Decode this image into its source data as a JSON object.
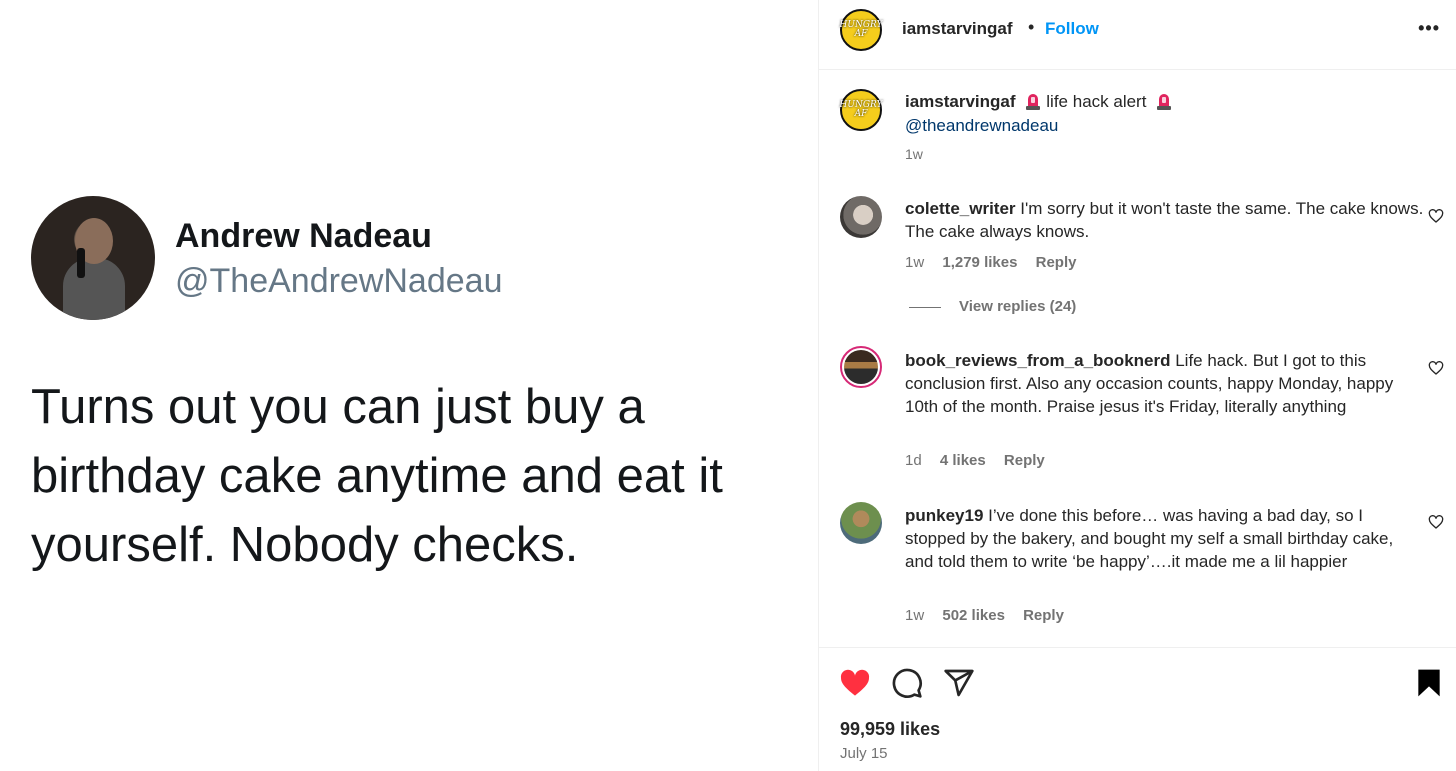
{
  "tweet": {
    "name": "Andrew Nadeau",
    "handle": "@TheAndrewNadeau",
    "text": "Turns out you can just buy a birthday cake anytime and eat it yourself. Nobody checks."
  },
  "header": {
    "username": "iamstarvingaf",
    "separator": "•",
    "follow_label": "Follow",
    "more_label": "•••",
    "avatar_text": "HUNGRY AF"
  },
  "caption": {
    "username": "iamstarvingaf",
    "text": "life hack alert",
    "mention": "@theandrewnadeau",
    "time": "1w"
  },
  "comments": [
    {
      "username": "colette_writer",
      "text": "I'm sorry but it won't taste the same. The cake knows. The cake always knows.",
      "time": "1w",
      "likes": "1,279 likes",
      "reply_label": "Reply",
      "view_replies": "View replies (24)"
    },
    {
      "username": "book_reviews_from_a_booknerd",
      "text": "Life hack. But I got to this conclusion first. Also any occasion counts, happy Monday, happy 10th of the month. Praise jesus it's Friday, literally anything",
      "time": "1d",
      "likes": "4 likes",
      "reply_label": "Reply"
    },
    {
      "username": "punkey19",
      "text": "I’ve done this before… was having a bad day, so I stopped by the bakery, and bought my self a small birthday cake, and told them to write ‘be happy’….it made me a lil happier",
      "time": "1w",
      "likes": "502 likes",
      "reply_label": "Reply"
    }
  ],
  "footer": {
    "likes": "99,959 likes",
    "date": "July 15"
  },
  "colors": {
    "accent": "#0095f6",
    "like_red": "#ff3040",
    "mention": "#00376b",
    "muted": "#737373"
  },
  "icons": [
    "heart-filled-icon",
    "comment-icon",
    "share-icon",
    "bookmark-filled-icon",
    "heart-outline-icon",
    "siren-icon",
    "more-icon"
  ]
}
